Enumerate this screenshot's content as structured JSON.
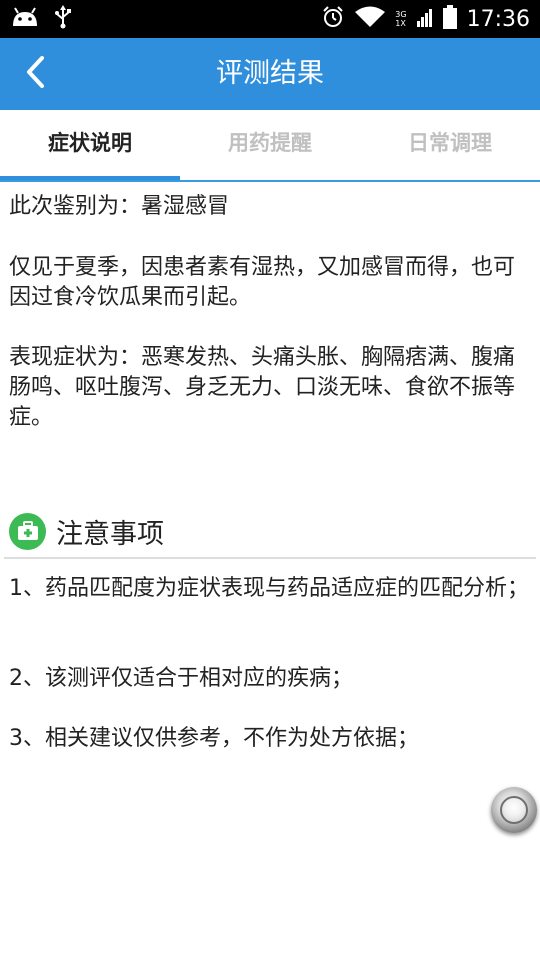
{
  "status_bar": {
    "time": "17:36",
    "network_label_top": "3G",
    "network_label_bottom": "1X",
    "icons": [
      "android-icon",
      "usb-icon",
      "alarm-icon",
      "wifi-icon",
      "signal-icon",
      "battery-icon"
    ]
  },
  "app_bar": {
    "title": "评测结果",
    "back_icon": "chevron-left-icon",
    "background_color": "#2f8fdc"
  },
  "tabs": [
    {
      "label": "症状说明",
      "active": true
    },
    {
      "label": "用药提醒",
      "active": false
    },
    {
      "label": "日常调理",
      "active": false
    }
  ],
  "content": {
    "diagnosis": "此次鉴别为：暑湿感冒",
    "cause": "仅见于夏季，因患者素有湿热，又加感冒而得，也可因过食冷饮瓜果而引起。",
    "symptoms": "表现症状为：恶寒发热、头痛头胀、胸隔痞满、腹痛肠鸣、呕吐腹泻、身乏无力、口淡无味、食欲不振等症。"
  },
  "notice": {
    "title": "注意事项",
    "icon": "medical-kit-icon",
    "items": [
      "1、药品匹配度为症状表现与药品适应症的匹配分析；",
      "2、该测评仅适合于相对应的疾病；",
      "3、相关建议仅供参考，不作为处方依据；"
    ]
  },
  "floating_button": {
    "icon": "assistive-touch-icon"
  }
}
